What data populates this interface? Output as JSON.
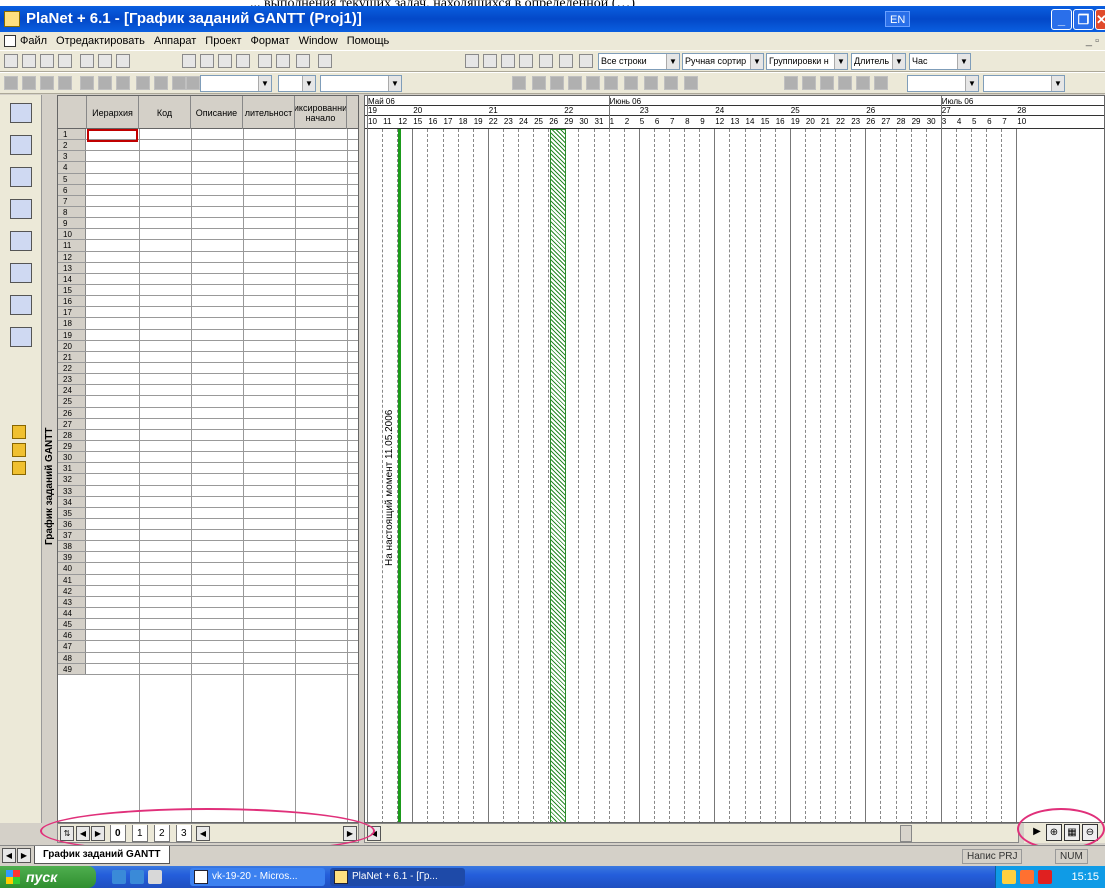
{
  "top_caption": "... выполнения текущих задач, находящихся в определенной (…)",
  "window": {
    "title": "PlaNet + 6.1 - [График заданий GANTT (Proj1)]",
    "lang": "EN"
  },
  "menu": [
    "Файл",
    "Отредактировать",
    "Аппарат",
    "Проект",
    "Формат",
    "Window",
    "Помощь"
  ],
  "toolbar": {
    "rows_combo": "Все строки",
    "sort_combo": "Ручная сортир",
    "group_combo": "Группировки н",
    "duration_combo": "Длитель",
    "unit_combo": "Час"
  },
  "grid": {
    "headers": [
      "Иерархия",
      "Код",
      "Описание",
      "лительност",
      "иксированни начало"
    ],
    "row_count": 49
  },
  "gantt": {
    "months": [
      {
        "label": "Май 06"
      },
      {
        "label": "Июнь 06"
      },
      {
        "label": "Июль 06"
      }
    ],
    "weeks": [
      "19",
      "20",
      "21",
      "22",
      "23",
      "24",
      "25",
      "26",
      "27",
      "28"
    ],
    "days": [
      "10",
      "11",
      "12",
      "15",
      "16",
      "17",
      "18",
      "19",
      "22",
      "23",
      "24",
      "25",
      "26",
      "29",
      "30",
      "31",
      "1",
      "2",
      "5",
      "6",
      "7",
      "8",
      "9",
      "12",
      "13",
      "14",
      "15",
      "16",
      "19",
      "20",
      "21",
      "22",
      "23",
      "26",
      "27",
      "28",
      "29",
      "30",
      "3",
      "4",
      "5",
      "6",
      "7",
      "10"
    ],
    "now_label": "На настоящий момент 11.05.2006"
  },
  "vertical_label": "График заданий GANTT",
  "grid_tabs": [
    "0",
    "1",
    "2",
    "3"
  ],
  "sheet_tab": "График заданий GANTT",
  "status": {
    "mode": "Напис PRJ",
    "num": "NUM"
  },
  "taskbar": {
    "start": "пуск",
    "tasks": [
      "vk-19-20 - Micros...",
      "PlaNet + 6.1 - [Гр..."
    ],
    "clock": "15:15"
  },
  "colors": {
    "titlebar": "#0348c8",
    "now_line": "#1b9a1b",
    "annotation": "#e0307a",
    "selected_cell": "#c00000"
  }
}
